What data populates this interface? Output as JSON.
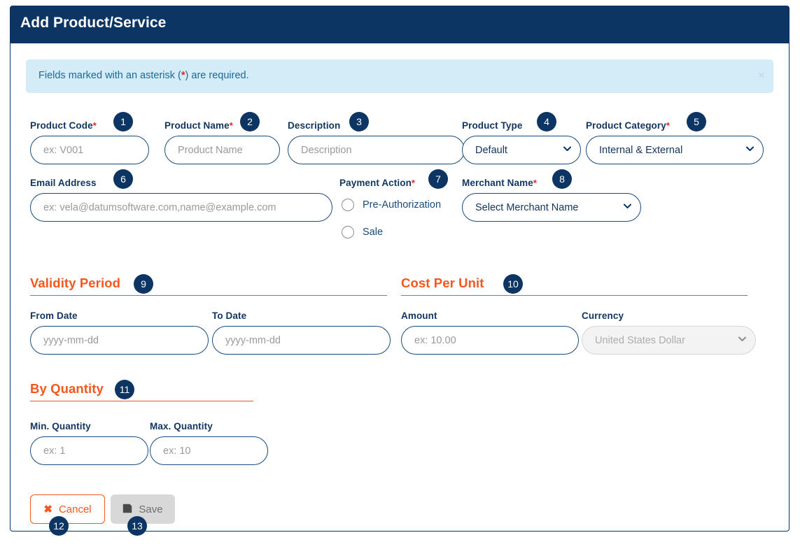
{
  "header": {
    "title": "Add Product/Service"
  },
  "alert": {
    "text_before": "Fields marked with an asterisk (",
    "star": "*",
    "text_after": ") are required.",
    "close_icon": "close-icon",
    "close_glyph": "×",
    "background": "#d3ecf7",
    "text_color": "#1c6a96"
  },
  "colors": {
    "header_bg": "#0d3564",
    "badge_bg": "#0d3564",
    "accent_orange": "#f4571d",
    "field_border": "#1a4b7d",
    "label": "#11355e",
    "required_star": "#e8232a"
  },
  "fields": {
    "product_code": {
      "label": "Product Code",
      "required": true,
      "placeholder": "ex: V001",
      "value": "",
      "badge": "1"
    },
    "product_name": {
      "label": "Product Name",
      "required": true,
      "placeholder": "Product Name",
      "value": "",
      "badge": "2"
    },
    "description": {
      "label": "Description",
      "required": false,
      "placeholder": "Description",
      "value": "",
      "badge": "3"
    },
    "product_type": {
      "label": "Product Type",
      "required": false,
      "selected": "Default",
      "options": [
        "Default"
      ],
      "badge": "4"
    },
    "product_category": {
      "label": "Product Category",
      "required": true,
      "selected": "Internal & External",
      "options": [
        "Internal & External"
      ],
      "badge": "5"
    },
    "email_address": {
      "label": "Email Address",
      "required": false,
      "placeholder": "ex: vela@datumsoftware.com,name@example.com",
      "value": "",
      "badge": "6"
    },
    "payment_action": {
      "label": "Payment Action",
      "required": true,
      "badge": "7",
      "options": [
        {
          "label": "Pre-Authorization",
          "selected": false
        },
        {
          "label": "Sale",
          "selected": false
        }
      ]
    },
    "merchant_name": {
      "label": "Merchant Name",
      "required": true,
      "selected": "Select Merchant Name",
      "options": [
        "Select Merchant Name"
      ],
      "badge": "8"
    },
    "from_date": {
      "label": "From Date",
      "required": false,
      "placeholder": "yyyy-mm-dd",
      "value": ""
    },
    "to_date": {
      "label": "To Date",
      "required": false,
      "placeholder": "yyyy-mm-dd",
      "value": ""
    },
    "amount": {
      "label": "Amount",
      "required": false,
      "placeholder": "ex: 10.00",
      "value": ""
    },
    "currency": {
      "label": "Currency",
      "required": false,
      "selected": "United States Dollar",
      "options": [
        "United States Dollar"
      ],
      "disabled": true
    },
    "min_quantity": {
      "label": "Min. Quantity",
      "required": false,
      "placeholder": "ex: 1",
      "value": ""
    },
    "max_quantity": {
      "label": "Max. Quantity",
      "required": false,
      "placeholder": "ex: 10",
      "value": ""
    }
  },
  "sections": {
    "validity_period": {
      "title": "Validity Period",
      "badge": "9"
    },
    "cost_per_unit": {
      "title": "Cost Per Unit",
      "badge": "10"
    },
    "by_quantity": {
      "title": "By Quantity",
      "badge": "11"
    }
  },
  "buttons": {
    "cancel": {
      "label": "Cancel",
      "icon": "times-icon",
      "glyph": "✖",
      "badge": "12",
      "disabled": false
    },
    "save": {
      "label": "Save",
      "icon": "floppy-disk-icon",
      "glyph": "🖫",
      "badge": "13",
      "disabled": true
    }
  }
}
